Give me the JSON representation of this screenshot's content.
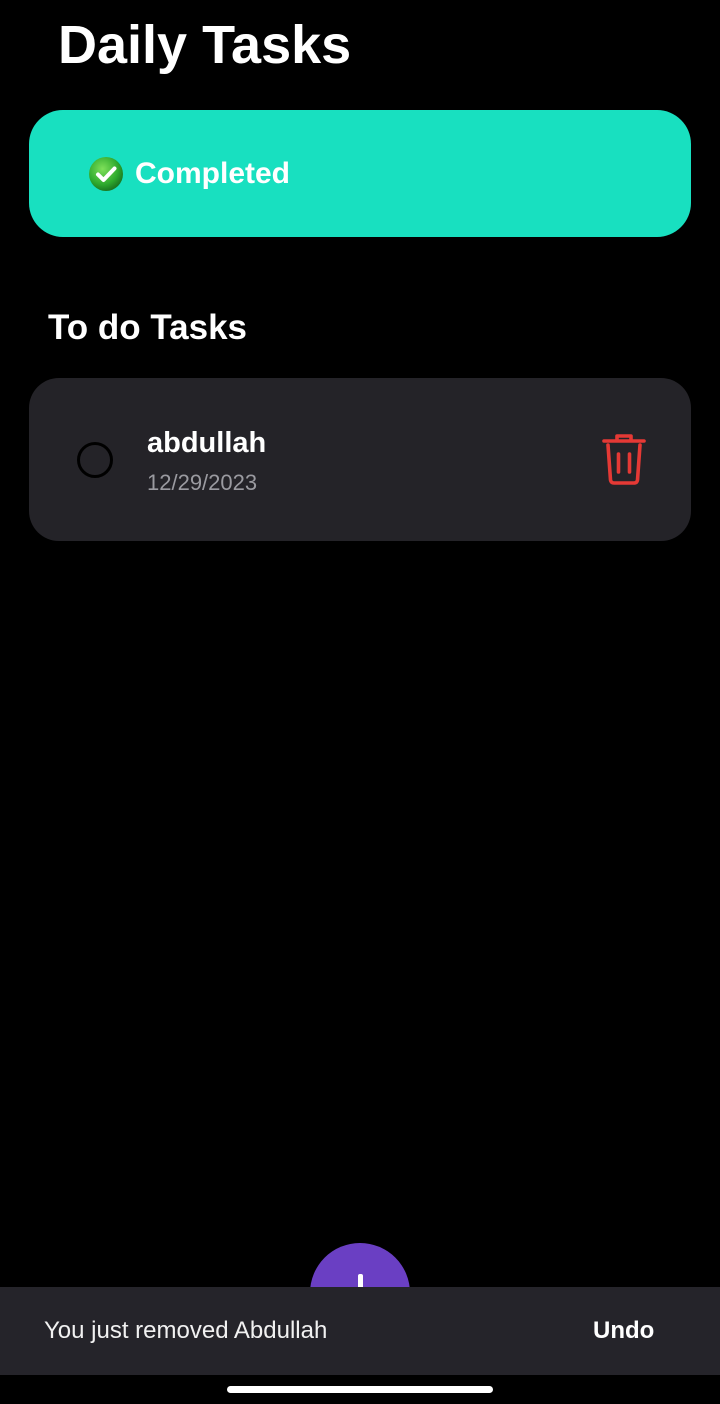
{
  "app": {
    "title": "Daily Tasks"
  },
  "completed": {
    "label": "Completed",
    "icon": "check-circle-icon",
    "color": "#18e0c0"
  },
  "todo": {
    "section_title": "To do Tasks",
    "tasks": [
      {
        "name": "abdullah",
        "date": "12/29/2023",
        "checked": false,
        "delete_icon": "trash-icon"
      }
    ]
  },
  "fab": {
    "icon": "plus-icon",
    "color": "#6a3fc3"
  },
  "snackbar": {
    "message": "You just removed Abdullah",
    "action_label": "Undo"
  },
  "colors": {
    "background": "#000000",
    "card": "#242328",
    "delete": "#e53935"
  }
}
